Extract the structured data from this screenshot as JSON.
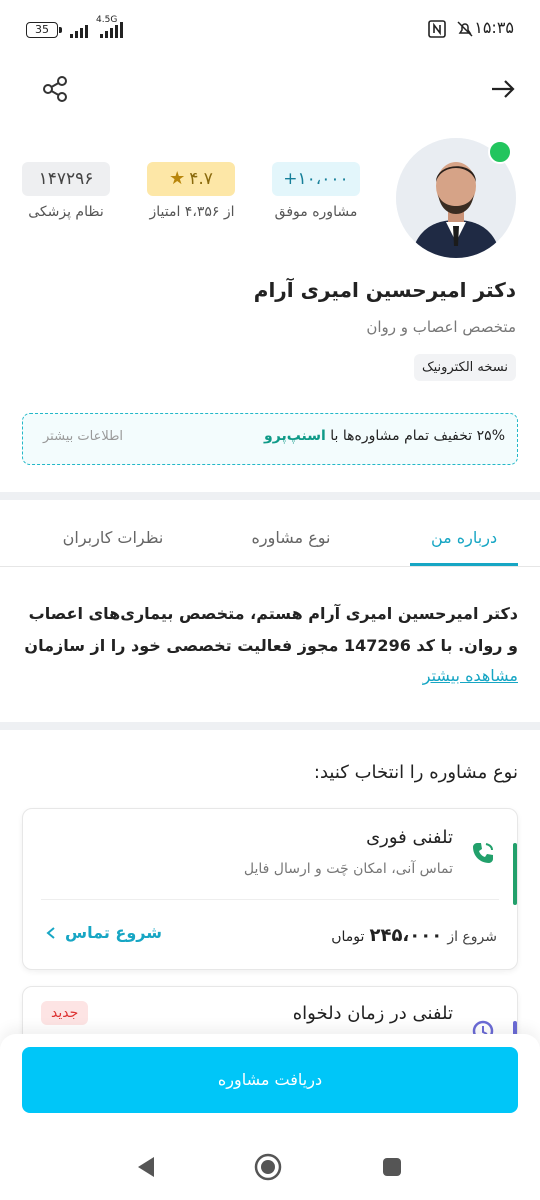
{
  "status_bar": {
    "battery": "35",
    "network": "4.5G",
    "time": "۱۵:۳۵"
  },
  "doctor": {
    "name": "دکتر امیرحسین امیری آرام",
    "specialty": "متخصص اعصاب و روان",
    "prescription_tag": "نسخه الکترونیک"
  },
  "stats": {
    "consultations_value": "+۱۰،۰۰۰",
    "consultations_label": "مشاوره موفق",
    "rating_value": "۴.۷",
    "rating_label": "از ۴،۳۵۶ امتیاز",
    "medical_code_value": "۱۴۷۲۹۶",
    "medical_code_label": "نظام پزشکی"
  },
  "promo": {
    "text_prefix": "۲۵% تخفیف تمام مشاوره‌ها با",
    "brand": "اسنپ‌پرو",
    "more_info": "اطلاعات بیشتر"
  },
  "tabs": [
    {
      "label": "درباره من",
      "active": true
    },
    {
      "label": "نوع مشاوره",
      "active": false
    },
    {
      "label": "نظرات کاربران",
      "active": false
    }
  ],
  "about": {
    "text": "دکتر امیرحسین امیری آرام هستم، متخصص بیماری‌های اعصاب و روان. با کد 147296 مجوز فعالیت تخصصی خود را از سازمان",
    "more_link": "مشاهده بیشتر"
  },
  "consult_section": {
    "title": "نوع مشاوره را انتخاب کنید:",
    "cards": [
      {
        "title": "تلفنی فوری",
        "subtitle": "تماس آنی، امکان چَت و ارسال فایل",
        "price_prefix": "شروع از",
        "price": "۲۴۵،۰۰۰",
        "currency": "توماں",
        "action": "شروع تماس",
        "accent": "#22a06b"
      },
      {
        "title": "تلفنی در زمان دلخواه",
        "badge": "جدید",
        "accent": "#6b6bd6"
      }
    ]
  },
  "cta": {
    "label": "دریافت مشاوره"
  },
  "colors": {
    "primary": "#17a6c4",
    "cta": "#00c6f8",
    "online": "#22c55e",
    "rating_bg": "#fde7a7"
  },
  "icons": [
    "share-icon",
    "arrow-right-icon",
    "star-icon",
    "phone-icon",
    "chevron-left-icon",
    "nav-back-icon",
    "nav-home-icon",
    "nav-recents-icon"
  ]
}
